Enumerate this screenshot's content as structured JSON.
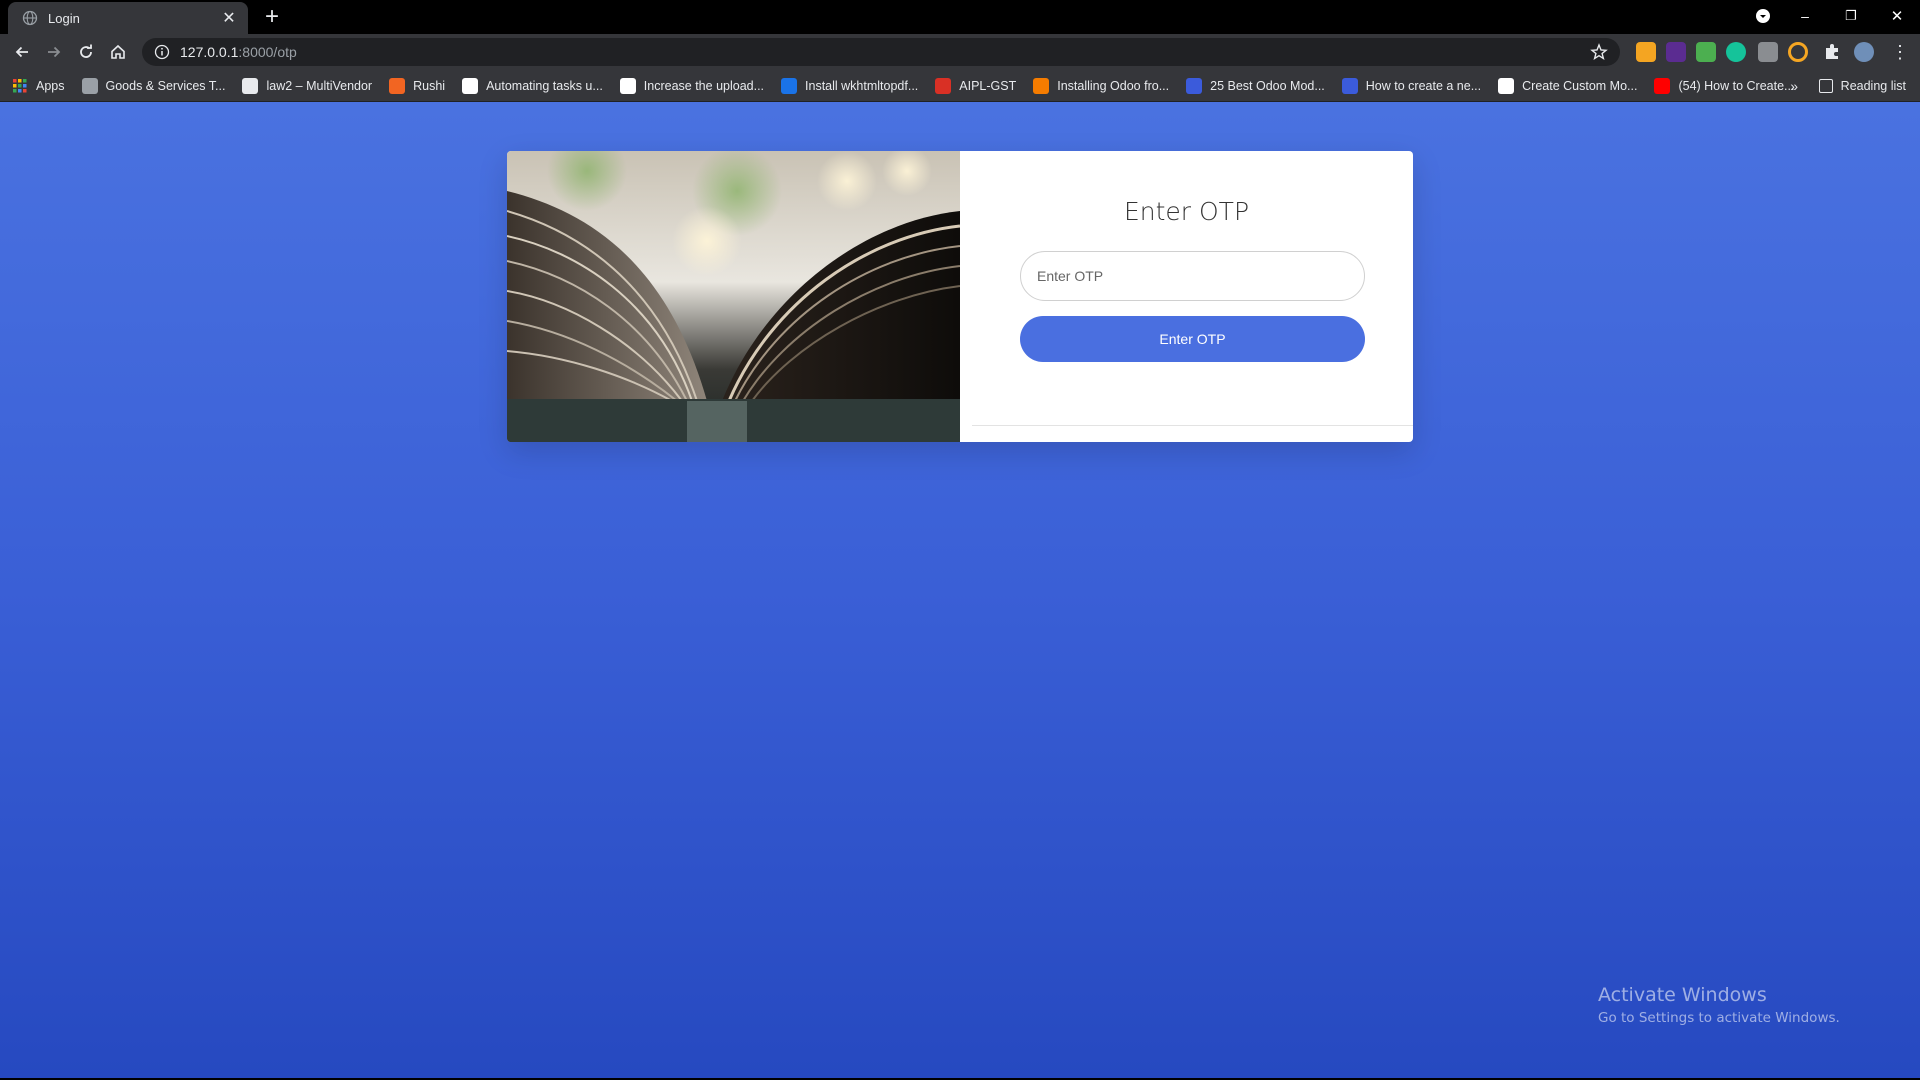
{
  "tab": {
    "title": "Login",
    "close": "✕",
    "new_tab": "+"
  },
  "window_controls": {
    "minimize": "–",
    "restore": "❐",
    "close": "✕"
  },
  "address_bar": {
    "host": "127.0.0.1",
    "path": ":8000/otp"
  },
  "bookmarks": [
    {
      "label": "Apps",
      "icon": "apps-grid-icon",
      "color": "#e8eaed"
    },
    {
      "label": "Goods & Services T...",
      "icon": "gst-icon",
      "color": "#9aa0a6"
    },
    {
      "label": "law2 – MultiVendor",
      "icon": "wordpress-icon",
      "color": "#e8eaed"
    },
    {
      "label": "Rushi",
      "icon": "rushi-icon",
      "color": "#f26522"
    },
    {
      "label": "Automating tasks u...",
      "icon": "medium-icon",
      "color": "#ffffff"
    },
    {
      "label": "Increase the upload...",
      "icon": "medium-icon",
      "color": "#ffffff"
    },
    {
      "label": "Install wkhtmltopdf...",
      "icon": "site-icon",
      "color": "#1a73e8"
    },
    {
      "label": "AIPL-GST",
      "icon": "aipl-icon",
      "color": "#d93025"
    },
    {
      "label": "Installing Odoo fro...",
      "icon": "chevron-icon",
      "color": "#f57c00"
    },
    {
      "label": "25 Best Odoo Mod...",
      "icon": "webkul-icon",
      "color": "#3b5bdb"
    },
    {
      "label": "How to create a ne...",
      "icon": "webkul-icon",
      "color": "#3b5bdb"
    },
    {
      "label": "Create Custom Mo...",
      "icon": "medium-icon",
      "color": "#ffffff"
    },
    {
      "label": "(54) How to Create...",
      "icon": "youtube-icon",
      "color": "#ff0000"
    }
  ],
  "bookmarks_overflow": "»",
  "reading_list": "Reading list",
  "card": {
    "title": "Enter OTP",
    "input_placeholder": "Enter OTP",
    "input_value": "",
    "button_label": "Enter OTP"
  },
  "watermark": {
    "line1": "Activate Windows",
    "line2": "Go to Settings to activate Windows."
  },
  "colors": {
    "page_gradient_top": "#4a72e0",
    "page_gradient_bottom": "#2649c0",
    "button": "#4a6fe0"
  }
}
